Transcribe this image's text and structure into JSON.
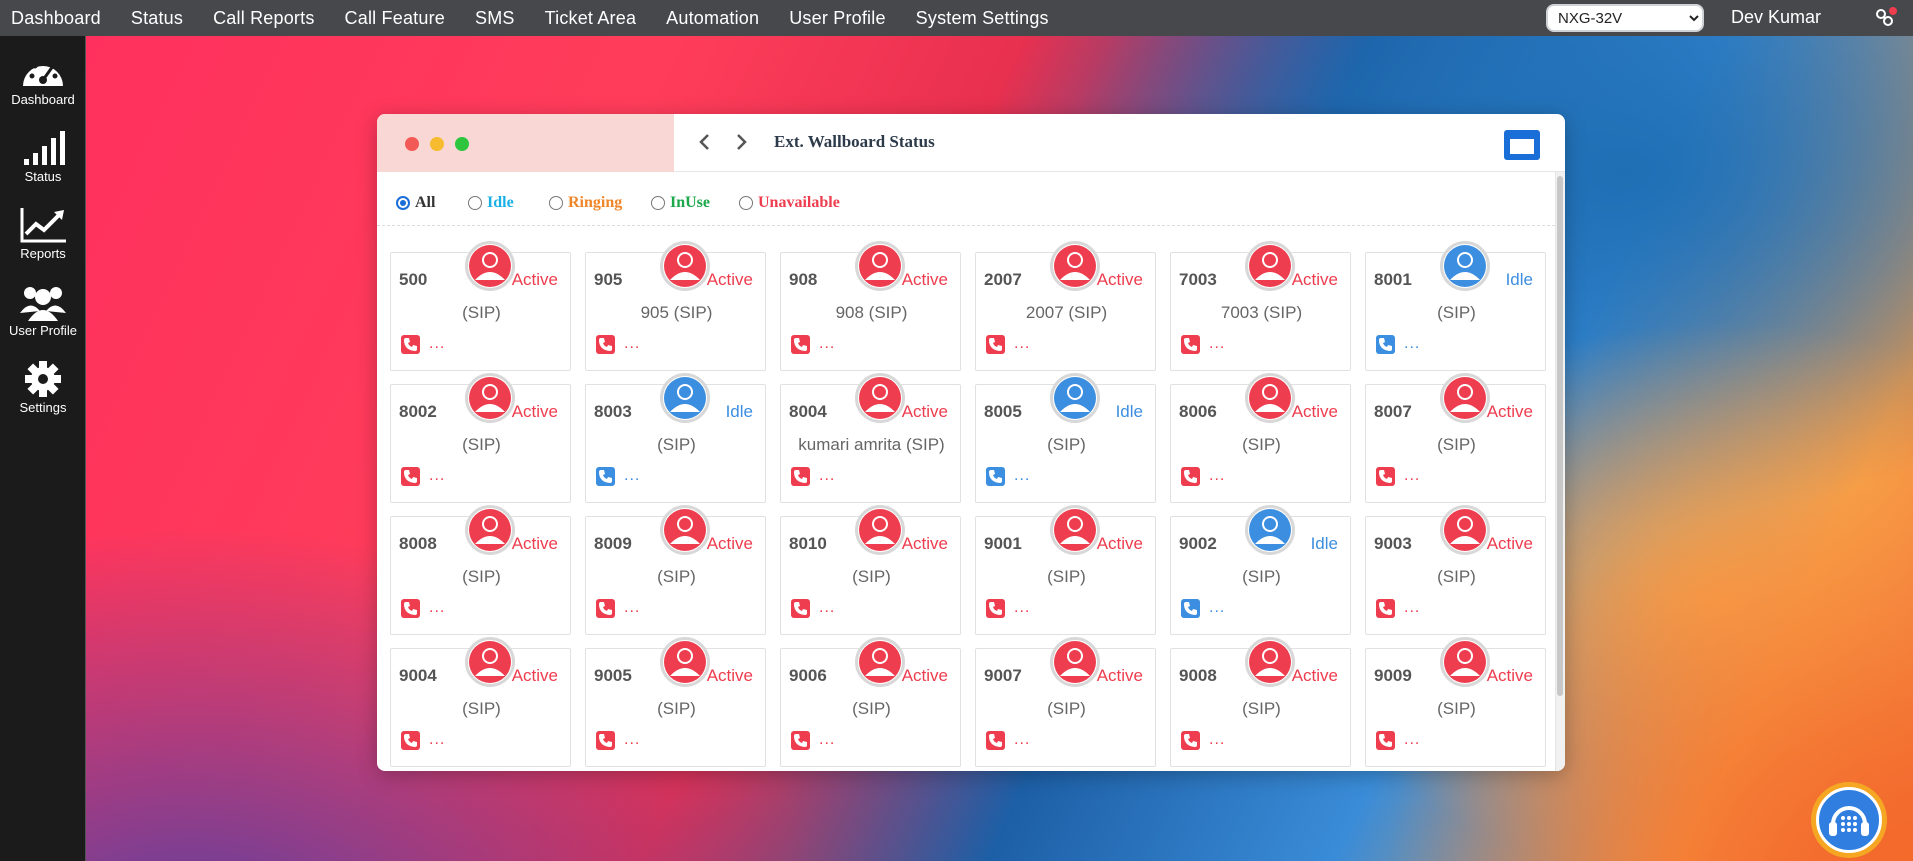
{
  "topbar": {
    "menu": [
      "Dashboard",
      "Status",
      "Call Reports",
      "Call Feature",
      "SMS",
      "Ticket Area",
      "Automation",
      "User Profile",
      "System Settings"
    ],
    "device_selected": "NXG-32V",
    "user_name": "Dev Kumar"
  },
  "sidebar": {
    "items": [
      {
        "label": "Dashboard",
        "icon": "speedometer-icon"
      },
      {
        "label": "Status",
        "icon": "signal-bars-icon"
      },
      {
        "label": "Reports",
        "icon": "trend-chart-icon"
      },
      {
        "label": "User Profile",
        "icon": "users-icon"
      },
      {
        "label": "Settings",
        "icon": "gear-icon"
      }
    ]
  },
  "window": {
    "title": "Ext. Wallboard Status"
  },
  "filters": [
    {
      "label": "All",
      "color": "#333333",
      "checked": true
    },
    {
      "label": "Idle",
      "color": "#1ab0e6",
      "checked": false
    },
    {
      "label": "Ringing",
      "color": "#f0862a",
      "checked": false
    },
    {
      "label": "InUse",
      "color": "#1aa84a",
      "checked": false
    },
    {
      "label": "Unavailable",
      "color": "#ee3d4e",
      "checked": false
    }
  ],
  "colors": {
    "active": "#ee3d4e",
    "idle": "#3c8ee0"
  },
  "extensions": [
    {
      "ext": "500",
      "state": "Active",
      "name": "(SIP)"
    },
    {
      "ext": "905",
      "state": "Active",
      "name": "905 (SIP)"
    },
    {
      "ext": "908",
      "state": "Active",
      "name": "908 (SIP)"
    },
    {
      "ext": "2007",
      "state": "Active",
      "name": "2007 (SIP)"
    },
    {
      "ext": "7003",
      "state": "Active",
      "name": "7003 (SIP)"
    },
    {
      "ext": "8001",
      "state": "Idle",
      "name": "(SIP)"
    },
    {
      "ext": "8002",
      "state": "Active",
      "name": "(SIP)"
    },
    {
      "ext": "8003",
      "state": "Idle",
      "name": "(SIP)"
    },
    {
      "ext": "8004",
      "state": "Active",
      "name": "kumari amrita (SIP)"
    },
    {
      "ext": "8005",
      "state": "Idle",
      "name": "(SIP)"
    },
    {
      "ext": "8006",
      "state": "Active",
      "name": "(SIP)"
    },
    {
      "ext": "8007",
      "state": "Active",
      "name": "(SIP)"
    },
    {
      "ext": "8008",
      "state": "Active",
      "name": "(SIP)"
    },
    {
      "ext": "8009",
      "state": "Active",
      "name": "(SIP)"
    },
    {
      "ext": "8010",
      "state": "Active",
      "name": "(SIP)"
    },
    {
      "ext": "9001",
      "state": "Active",
      "name": "(SIP)"
    },
    {
      "ext": "9002",
      "state": "Idle",
      "name": "(SIP)"
    },
    {
      "ext": "9003",
      "state": "Active",
      "name": "(SIP)"
    },
    {
      "ext": "9004",
      "state": "Active",
      "name": "(SIP)"
    },
    {
      "ext": "9005",
      "state": "Active",
      "name": "(SIP)"
    },
    {
      "ext": "9006",
      "state": "Active",
      "name": "(SIP)"
    },
    {
      "ext": "9007",
      "state": "Active",
      "name": "(SIP)"
    },
    {
      "ext": "9008",
      "state": "Active",
      "name": "(SIP)"
    },
    {
      "ext": "9009",
      "state": "Active",
      "name": "(SIP)"
    }
  ],
  "card_more": "..."
}
